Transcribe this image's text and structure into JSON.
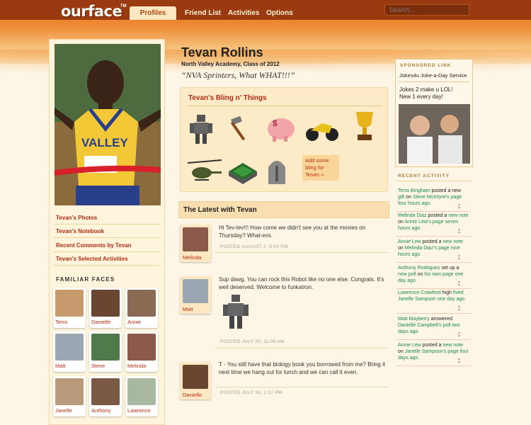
{
  "header": {
    "logo": "ourface",
    "logo_tm": "TM",
    "nav": [
      "Profiles",
      "Friend List",
      "Activities",
      "Options"
    ],
    "search_placeholder": "Search..."
  },
  "profile": {
    "name": "Tevan Rollins",
    "school": "North Valley Academy, Class of 2012",
    "quote": "“NVA Sprinters, What WHAT!!!”",
    "links": [
      "Tevan’s Photos",
      "Tevan’s Notebook",
      "Recent Comments by Tevan",
      "Tevan’s Selected Activities"
    ]
  },
  "familiar_faces": {
    "title": "FAMILIAR FACES",
    "people": [
      "Terra",
      "Danielle",
      "Annie",
      "Matt",
      "Steve",
      "Melinda",
      "Janelle",
      "Anthony",
      "Lawrence"
    ]
  },
  "bling": {
    "title": "Tevan’s Bling n’ Things",
    "items": [
      "robot-icon",
      "hammer-icon",
      "piggy-bank-icon",
      "motorcycle-icon",
      "trophy-icon",
      "helicopter-icon",
      "stadium-icon",
      "helmet-icon"
    ],
    "add_label": "Add some bling for Tevan »"
  },
  "latest": {
    "title": "The Latest with Tevan",
    "posts": [
      {
        "author": "Melinda",
        "text": "Hi Tev-tev!!!  How come we didn’t see you at the movies on Thursday?  What-evs.",
        "meta": "POSTED AUGUST 2, 8:00 PM"
      },
      {
        "author": "Matt",
        "text": "Sup dawg.  You can rock this Robot like no one else. Congrats.  It’s well deserved.  Welcome to funkatron.",
        "meta": "POSTED JULY 20, 11:00 AM"
      },
      {
        "author": "Danielle",
        "text": "T - You still have that biology book you borrowed from me? Bring it next time we hang out for lunch and we can call it even.",
        "meta": "POSTED JULY 16, 1:37 PM"
      }
    ]
  },
  "sponsor": {
    "label": "SPONSORED LINK",
    "name": "Jokes4u Joke-a-Day Service",
    "line1": "Jokes 2 make u LOL!",
    "line2": "New 1 every day!"
  },
  "recent_activity": {
    "title": "RECENT ACTIVITY",
    "items": [
      {
        "who": "Terra Bingham",
        "mid": " posted a new ",
        "what": "gift",
        "rest": " on ",
        "target": "Steve McIntyre’s page four hours ago."
      },
      {
        "who": "Melinda Diaz",
        "mid": " posted a ",
        "what": "new note",
        "rest": " on ",
        "target": "Annie Lew’s page seven hours ago."
      },
      {
        "who": "Annie Lew",
        "mid": " posted a ",
        "what": "new note",
        "rest": " on ",
        "target": "Melinda Diaz’s page nine hours ago."
      },
      {
        "who": "Anthony Rodriguez",
        "mid": " set up a ",
        "what": "new poll",
        "rest": " on ",
        "target": "his own page one day ago."
      },
      {
        "who": "Lawrence Crawford",
        "mid": " high ",
        "what": "fived",
        "rest": " ",
        "target": "Janelle Sampson one day ago."
      },
      {
        "who": "Matt Mayberry",
        "mid": " answered ",
        "what": "Danielle Campbell’s poll",
        "rest": " ",
        "target": "two days ago."
      },
      {
        "who": "Annie Lew",
        "mid": " posted a ",
        "what": "new note",
        "rest": " on ",
        "target": "Janelle Sampson’s page four days ago."
      }
    ]
  },
  "colors": {
    "accent": "#e9701e",
    "link_red": "#b52a14",
    "activity_green": "#1a8a4a"
  }
}
